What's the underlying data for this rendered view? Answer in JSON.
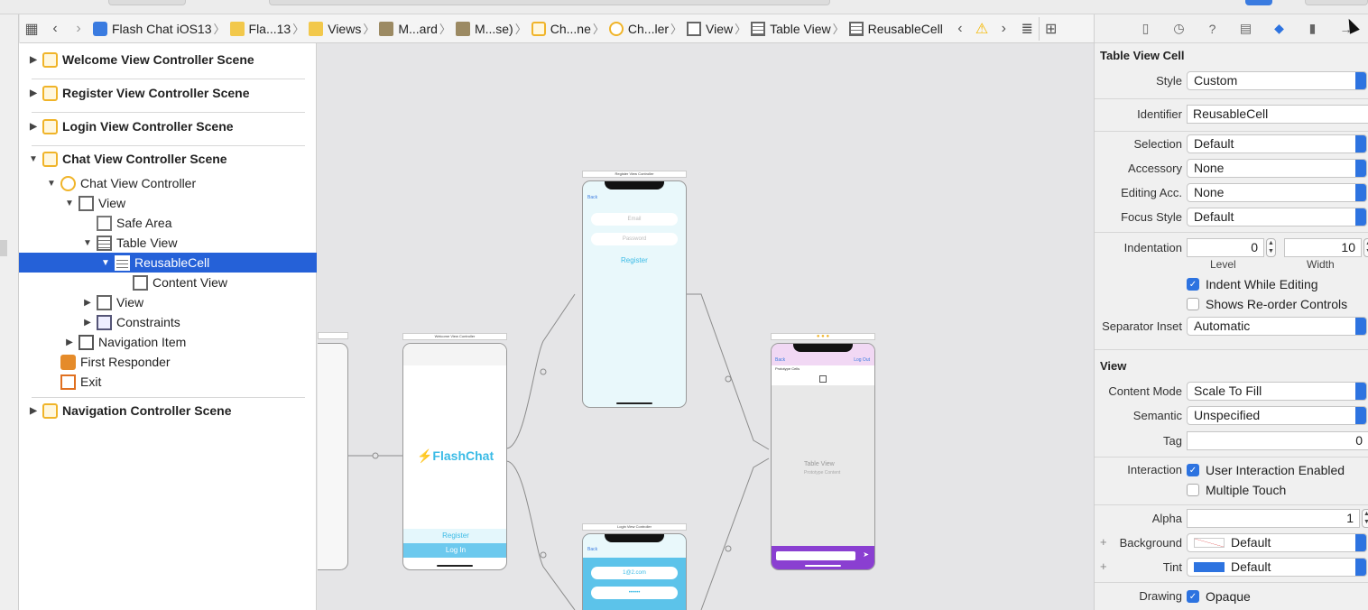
{
  "breadcrumb": {
    "items": [
      {
        "label": "Flash Chat iOS13",
        "icon": "app-icon"
      },
      {
        "label": "Fla...13",
        "icon": "folder-icon"
      },
      {
        "label": "Views",
        "icon": "folder-icon"
      },
      {
        "label": "M...ard",
        "icon": "storyboard-icon"
      },
      {
        "label": "M...se)",
        "icon": "storyboard-icon"
      },
      {
        "label": "Ch...ne",
        "icon": "scene-icon"
      },
      {
        "label": "Ch...ler",
        "icon": "view-controller-icon"
      },
      {
        "label": "View",
        "icon": "view-icon"
      },
      {
        "label": "Table View",
        "icon": "table-view-icon"
      },
      {
        "label": "ReusableCell",
        "icon": "table-cell-icon"
      }
    ]
  },
  "outline": {
    "scenes": [
      "Welcome View Controller Scene",
      "Register View Controller Scene",
      "Login View Controller Scene",
      "Chat View Controller Scene",
      "Navigation Controller Scene"
    ],
    "items": {
      "chat_vc": "Chat View Controller",
      "view": "View",
      "safe_area": "Safe Area",
      "table_view": "Table View",
      "reusable_cell": "ReusableCell",
      "content_view": "Content View",
      "view2": "View",
      "constraints": "Constraints",
      "nav_item": "Navigation Item",
      "first_responder": "First Responder",
      "exit": "Exit"
    }
  },
  "canvas": {
    "register_title": "Register View Controller",
    "register_email": "Email",
    "register_password": "Password",
    "register_button": "Register",
    "back": "Back",
    "welcome_title": "Welcome View Controller",
    "welcome_logo": "⚡FlashChat",
    "welcome_register": "Register",
    "welcome_login": "Log In",
    "partial_text": "oller",
    "chat_back": "Back",
    "chat_logout": "Log Out",
    "chat_prototype": "Prototype Cells",
    "chat_tableview": "Table View",
    "chat_prototype_content": "Prototype Content",
    "login_title": "Login View Controller",
    "login_email": "1@2.com",
    "login_password": "••••••"
  },
  "inspector": {
    "section_cell": "Table View Cell",
    "style_label": "Style",
    "style_value": "Custom",
    "identifier_label": "Identifier",
    "identifier_value": "ReusableCell",
    "selection_label": "Selection",
    "selection_value": "Default",
    "accessory_label": "Accessory",
    "accessory_value": "None",
    "editing_label": "Editing Acc.",
    "editing_value": "None",
    "focus_label": "Focus Style",
    "focus_value": "Default",
    "indentation_label": "Indentation",
    "level_value": "0",
    "width_value": "10",
    "level_sub": "Level",
    "width_sub": "Width",
    "indent_editing": "Indent While Editing",
    "reorder": "Shows Re-order Controls",
    "separator_label": "Separator Inset",
    "separator_value": "Automatic",
    "section_view": "View",
    "content_mode_label": "Content Mode",
    "content_mode_value": "Scale To Fill",
    "semantic_label": "Semantic",
    "semantic_value": "Unspecified",
    "tag_label": "Tag",
    "tag_value": "0",
    "interaction_label": "Interaction",
    "user_interaction": "User Interaction Enabled",
    "multiple_touch": "Multiple Touch",
    "alpha_label": "Alpha",
    "alpha_value": "1",
    "background_label": "Background",
    "background_value": "Default",
    "tint_label": "Tint",
    "tint_value": "Default",
    "drawing_label": "Drawing",
    "opaque": "Opaque"
  },
  "colors": {
    "selection": "#2561d8",
    "accent": "#2d73e0",
    "flashchat_blue": "#3bbbe6",
    "chat_purple": "#8a3fd1"
  }
}
